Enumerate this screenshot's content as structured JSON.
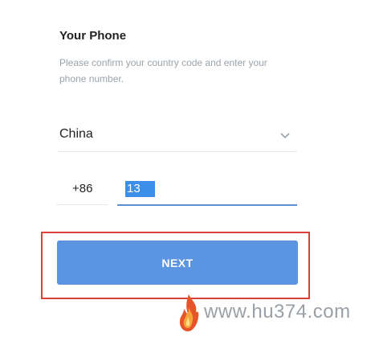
{
  "header": {
    "title": "Your Phone",
    "description": "Please confirm your country code and enter your phone number."
  },
  "country": {
    "selected": "China",
    "icon": "chevron-down-icon"
  },
  "phone": {
    "country_code": "+86",
    "number_value": "13"
  },
  "actions": {
    "next_label": "NEXT"
  },
  "watermark": {
    "text": "www.hu374.com",
    "icon": "flame-logo"
  },
  "colors": {
    "button": "#5b94e0",
    "input_focus": "#5b8ed8",
    "selection": "#3b8fe8",
    "annotation_box": "#d9413b"
  }
}
